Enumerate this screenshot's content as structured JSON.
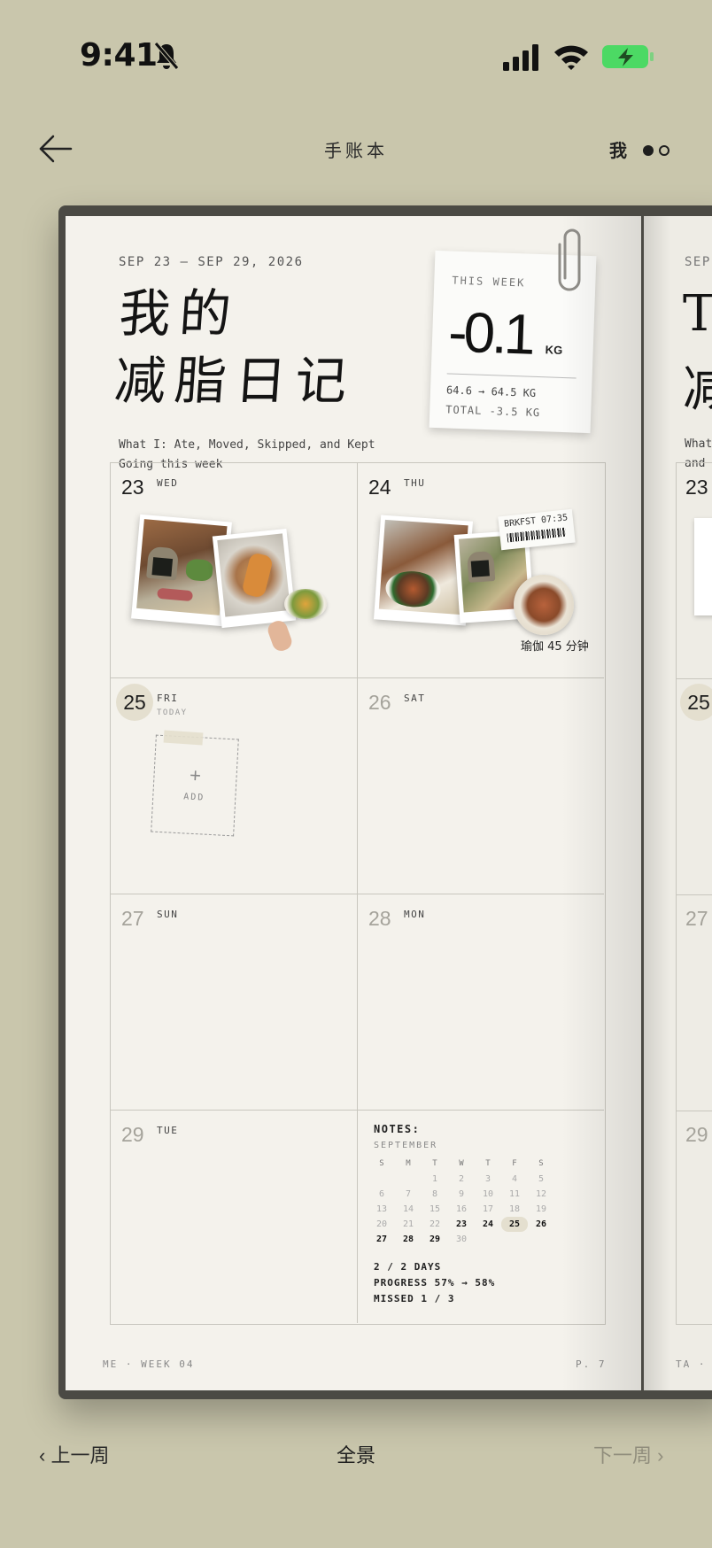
{
  "status_bar": {
    "time": "9:41",
    "colors": {
      "battery": "#4cd964"
    }
  },
  "nav": {
    "title": "手账本",
    "me_label": "我",
    "page_dots": 2,
    "active_dot": 0
  },
  "journal": {
    "date_range": "SEP 23 — SEP 29, 2026",
    "title_line1": "我的",
    "title_line2": "减脂日记",
    "subtitle": "What I: Ate, Moved, Skipped, and Kept Going this week",
    "week_card": {
      "label": "THIS WEEK",
      "value": "-0.1",
      "unit": "KG",
      "range": "64.6 → 64.5 KG",
      "total": "TOTAL -3.5 KG"
    },
    "days": [
      {
        "num": "23",
        "name": "WED"
      },
      {
        "num": "24",
        "name": "THU",
        "ticket": "BRKFST 07:35",
        "caption": "瑜伽 45 分钟"
      },
      {
        "num": "25",
        "name": "FRI",
        "sub": "TODAY",
        "add_label": "ADD",
        "add_plus": "+"
      },
      {
        "num": "26",
        "name": "SAT"
      },
      {
        "num": "27",
        "name": "SUN"
      },
      {
        "num": "28",
        "name": "MON"
      },
      {
        "num": "29",
        "name": "TUE"
      }
    ],
    "notes": {
      "title": "NOTES:",
      "month": "SEPTEMBER",
      "weekdays": [
        "S",
        "M",
        "T",
        "W",
        "T",
        "F",
        "S"
      ],
      "weeks": [
        [
          "",
          "",
          "1",
          "2",
          "3",
          "4",
          "5"
        ],
        [
          "6",
          "7",
          "8",
          "9",
          "10",
          "11",
          "12"
        ],
        [
          "13",
          "14",
          "15",
          "16",
          "17",
          "18",
          "19"
        ],
        [
          "20",
          "21",
          "22",
          "23",
          "24",
          "25",
          "26"
        ],
        [
          "27",
          "28",
          "29",
          "30",
          "",
          "",
          ""
        ]
      ],
      "stats": [
        "2 / 2 DAYS",
        "PROGRESS 57% → 58%",
        "MISSED 1 / 3"
      ]
    },
    "footer_left": "ME · WEEK 04",
    "footer_right": "P. 7"
  },
  "next_page": {
    "date": "SEP",
    "title1": "T",
    "title2": "减",
    "sub1": "What",
    "sub2": "and",
    "days": [
      "23",
      "25",
      "27",
      "29"
    ],
    "footer": "TA ·"
  },
  "bottom_bar": {
    "prev": "‹ 上一周",
    "overview": "全景",
    "next": "下一周 ›"
  }
}
